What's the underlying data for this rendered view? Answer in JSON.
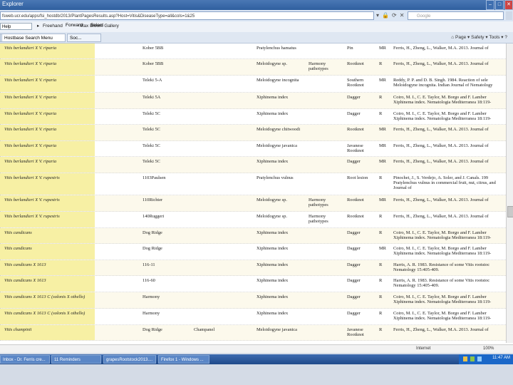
{
  "window": {
    "title": "Explorer",
    "controls": [
      "–",
      "□",
      "✕"
    ]
  },
  "address": {
    "url": "fsweb.ucr.edu/apps/fsi_hostdb/2013/PlantPagesResults.asp?Host=Vitis&DiseaseType=all&cols=1&25"
  },
  "search": {
    "placeholder": "Google"
  },
  "toolbar": {
    "find_value": "Help",
    "items": [
      "Freehand",
      "Max Bloom Gallery",
      "Forward",
      "Select"
    ]
  },
  "tabs": {
    "items": [
      "Hostbase Search Menu",
      "Soc..."
    ]
  },
  "commandbar": {
    "page": "Page ▾",
    "safety": "Safety ▾",
    "tools": "Tools ▾",
    "help": "?"
  },
  "table": {
    "rows": [
      {
        "host": "Vitis berlandieri X V. riparia",
        "rootstock": "Kober 5BB",
        "other": "",
        "pathogen": "Pratylenchus hamatus",
        "cat": "",
        "type": "Pin",
        "code": "MR",
        "ref": "Ferris, H., Zheng, L., Walker, M.A. 2013. Journal of"
      },
      {
        "host": "Vitis berlandieri X V. riparia",
        "rootstock": "Kober 5BB",
        "other": "",
        "pathogen": "Meloidogyne sp.",
        "cat": "Harmony pathotypes",
        "type": "Rootknot",
        "code": "R",
        "ref": "Ferris, H., Zheng, L., Walker, M.A. 2013. Journal of"
      },
      {
        "host": "Vitis berlandieri X V. riparia",
        "rootstock": "Teleki 5-A",
        "other": "",
        "pathogen": "Meloidogyne incognita",
        "cat": "",
        "type": "Southern Rootknot",
        "code": "MR",
        "ref": "Reddy, P. P. and D. B. Singh. 1984. Reaction of sele Meloidogyne incognita. Indian Journal of Nematology"
      },
      {
        "host": "Vitis berlandieri X V. riparia",
        "rootstock": "Teleki 5A",
        "other": "",
        "pathogen": "Xiphinema index",
        "cat": "",
        "type": "Dagger",
        "code": "R",
        "ref": "Coiro, M. I., C. E. Taylor, M. Borgo and F. Lamber Xiphinema index. Nematologia Mediterranea 18:119-"
      },
      {
        "host": "Vitis berlandieri X V. riparia",
        "rootstock": "Teleki 5C",
        "other": "",
        "pathogen": "Xiphinema index",
        "cat": "",
        "type": "Dagger",
        "code": "R",
        "ref": "Coiro, M. I., C. E. Taylor, M. Borgo and F. Lamber Xiphinema index. Nematologia Mediterranea 18:119-"
      },
      {
        "host": "Vitis berlandieri X V. riparia",
        "rootstock": "Teleki 5C",
        "other": "",
        "pathogen": "Meloidogyne chitwoodi",
        "cat": "",
        "type": "Rootknot",
        "code": "MR",
        "ref": "Ferris, H., Zheng, L., Walker, M.A. 2013. Journal of"
      },
      {
        "host": "Vitis berlandieri X V. riparia",
        "rootstock": "Teleki 5C",
        "other": "",
        "pathogen": "Meloidogyne javanica",
        "cat": "",
        "type": "Javanese Rootknot",
        "code": "MR",
        "ref": "Ferris, H., Zheng, L., Walker, M.A. 2013. Journal of"
      },
      {
        "host": "Vitis berlandieri X V. riparia",
        "rootstock": "Teleki 5C",
        "other": "",
        "pathogen": "Xiphinema index",
        "cat": "",
        "type": "Dagger",
        "code": "MR",
        "ref": "Ferris, H., Zheng, L., Walker, M.A. 2013. Journal of"
      },
      {
        "host": "Vitis berlandieri X V. rupestris",
        "rootstock": "1103Paulsen",
        "other": "",
        "pathogen": "Pratylenchus vulnus",
        "cat": "",
        "type": "Root lesion",
        "code": "R",
        "ref": "Pinochet, J., S. Verdejo, A. Soler, and J. Canals. 199 Pratylenchus vulnus in commercial fruit, nut, citrus, and Journal of"
      },
      {
        "host": "Vitis berlandieri X V. rupestris",
        "rootstock": "110Richter",
        "other": "",
        "pathogen": "Meloidogyne sp.",
        "cat": "Harmony pathotypes",
        "type": "Rootknot",
        "code": "MR",
        "ref": "Ferris, H., Zheng, L., Walker, M.A. 2013. Journal of"
      },
      {
        "host": "Vitis berlandieri X V. rupestris",
        "rootstock": "140Ruggeri",
        "other": "",
        "pathogen": "Meloidogyne sp.",
        "cat": "Harmony pathotypes",
        "type": "Rootknot",
        "code": "R",
        "ref": "Ferris, H., Zheng, L., Walker, M.A. 2013. Journal of"
      },
      {
        "host": "Vitis candicans",
        "rootstock": "Dog Ridge",
        "other": "",
        "pathogen": "Xiphinema index",
        "cat": "",
        "type": "Dagger",
        "code": "R",
        "ref": "Coiro, M. I., C. E. Taylor, M. Borgo and F. Lamber Xiphinema index. Nematologia Mediterranea 18:119-"
      },
      {
        "host": "Vitis candicans",
        "rootstock": "Dog Ridge",
        "other": "",
        "pathogen": "Xiphinema index",
        "cat": "",
        "type": "Dagger",
        "code": "MR",
        "ref": "Coiro, M. I., C. E. Taylor, M. Borgo and F. Lamber Xiphinema index. Nematologia Mediterranea 18:119-"
      },
      {
        "host": "Vitis candicans X 1613",
        "rootstock": "116-11",
        "other": "",
        "pathogen": "Xiphinema index",
        "cat": "",
        "type": "Dagger",
        "code": "R",
        "ref": "Harris, A. R. 1983. Resistance of some Vitis rootstoc Nematology 15:405-409."
      },
      {
        "host": "Vitis candicans X 1613",
        "rootstock": "116-60",
        "other": "",
        "pathogen": "Xiphinema index",
        "cat": "",
        "type": "Dagger",
        "code": "R",
        "ref": "Harris, A. R. 1983. Resistance of some Vitis rootstoc Nematology 15:405-409."
      },
      {
        "host": "Vitis candicans X 1613 C (solonis X othello)",
        "rootstock": "Harmony",
        "other": "",
        "pathogen": "Xiphinema index",
        "cat": "",
        "type": "Dagger",
        "code": "R",
        "ref": "Coiro, M. I., C. E. Taylor, M. Borgo and F. Lamber Xiphinema index. Nematologia Mediterranea 18:119-"
      },
      {
        "host": "Vitis candicans X 1613 C (solonis X othello)",
        "rootstock": "Harmony",
        "other": "",
        "pathogen": "Xiphinema index",
        "cat": "",
        "type": "Dagger",
        "code": "R",
        "ref": "Coiro, M. I., C. E. Taylor, M. Borgo and F. Lamber Xiphinema index. Nematologia Mediterranea 18:119-"
      },
      {
        "host": "Vitis champinii",
        "rootstock": "Dog Ridge",
        "other": "Champanel",
        "pathogen": "Meloidogyne javanica",
        "cat": "",
        "type": "Javanese Rootknot",
        "code": "R",
        "ref": "Ferris, H., Zheng, L., Walker, M.A. 2013. Journal of"
      }
    ]
  },
  "status": {
    "zone": "Internet",
    "zoom": "100%"
  },
  "taskbar": {
    "buttons": [
      "Inbox - Dr. Ferris cre...",
      "11 Reminders",
      "grapesRootstock2013....",
      "Firefox 1 - Windows ..."
    ],
    "clock": "11:47 AM"
  }
}
